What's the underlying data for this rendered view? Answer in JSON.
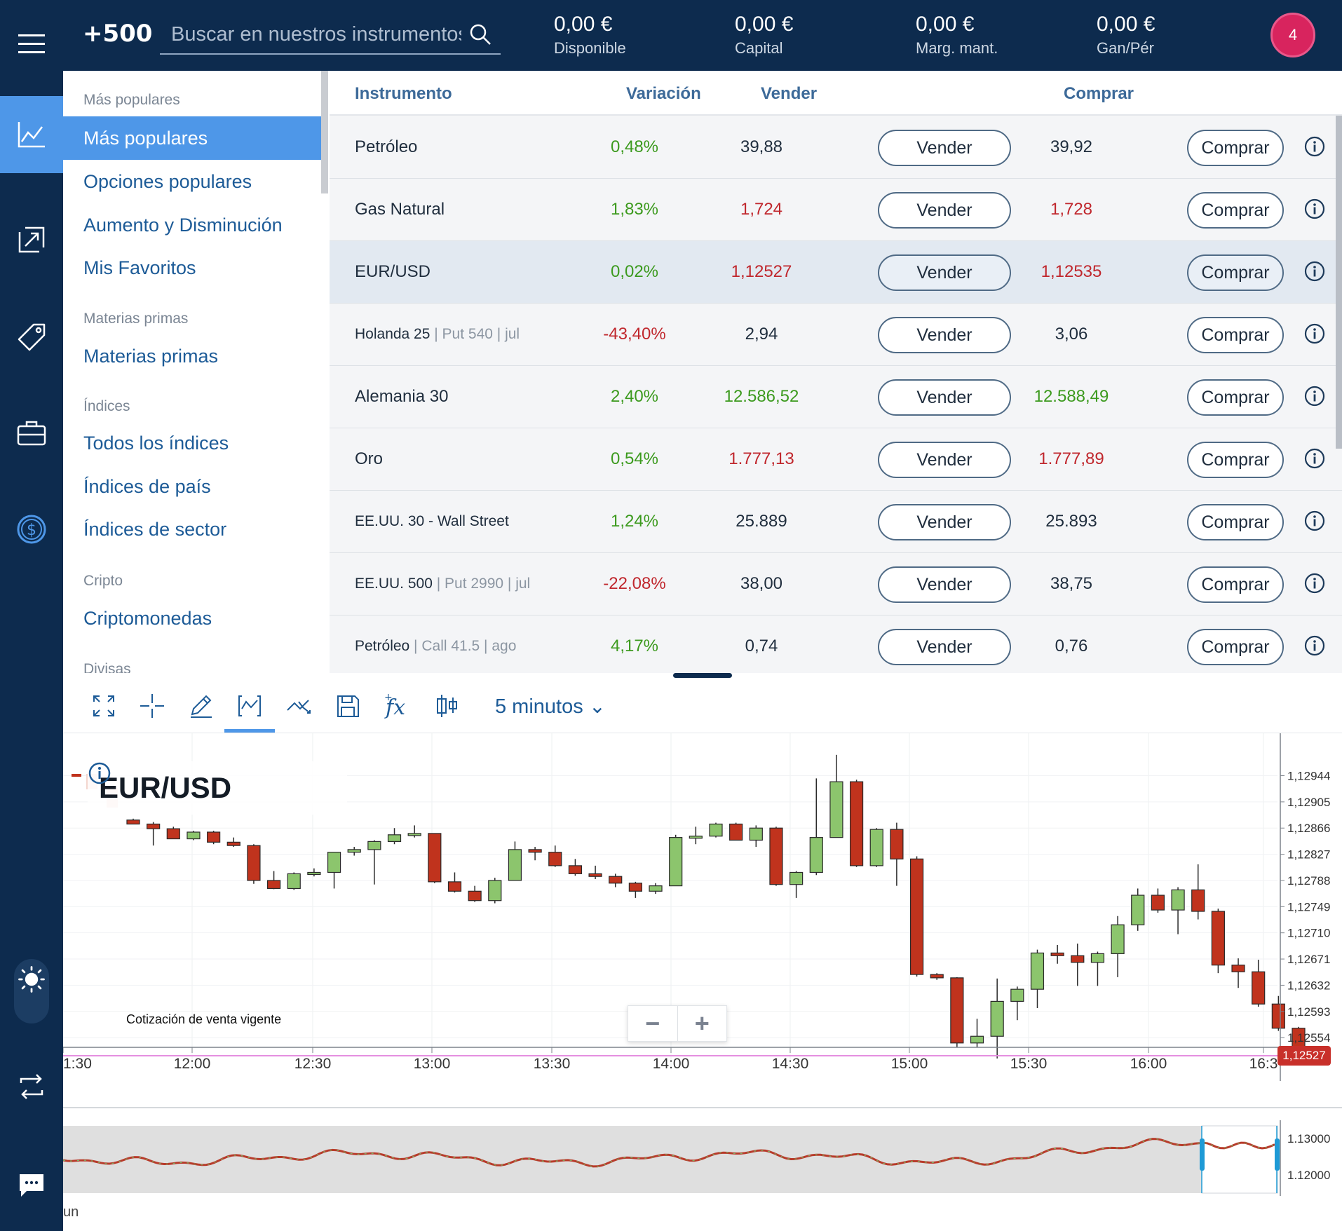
{
  "header": {
    "logo": "+500",
    "search_placeholder": "Buscar en nuestros instrumentos",
    "stats": [
      {
        "value": "0,00 €",
        "label": "Disponible"
      },
      {
        "value": "0,00 €",
        "label": "Capital"
      },
      {
        "value": "0,00 €",
        "label": "Marg. mant."
      },
      {
        "value": "0,00 €",
        "label": "Gan/Pér"
      }
    ],
    "notifications": "4"
  },
  "rail": [
    "menu-icon",
    "chart-icon",
    "trade-icon",
    "tag-icon",
    "briefcase-icon",
    "dollar-icon",
    "sun-icon",
    "swap-icon",
    "chat-icon"
  ],
  "categories": {
    "groups": [
      {
        "heading": "Más populares",
        "items": [
          "Más populares",
          "Opciones populares",
          "Aumento y Disminución",
          "Mis Favoritos"
        ]
      },
      {
        "heading": "Materias primas",
        "items": [
          "Materias primas"
        ]
      },
      {
        "heading": "Índices",
        "items": [
          "Todos los índices",
          "Índices de país",
          "Índices de sector"
        ]
      },
      {
        "heading": "Cripto",
        "items": [
          "Criptomonedas"
        ]
      },
      {
        "heading": "Divisas",
        "items": []
      }
    ],
    "active": "Más populares"
  },
  "table": {
    "headers": {
      "instrument": "Instrumento",
      "change": "Variación",
      "sell": "Vender",
      "buy": "Comprar"
    },
    "sell_label": "Vender",
    "buy_label": "Comprar",
    "rows": [
      {
        "name": "Petróleo",
        "sub": "",
        "change": "0,48%",
        "sell": "39,88",
        "buy": "39,92",
        "change_dir": "pos",
        "price_dir": "neu"
      },
      {
        "name": "Gas Natural",
        "sub": "",
        "change": "1,83%",
        "sell": "1,724",
        "buy": "1,728",
        "change_dir": "pos",
        "price_dir": "neg"
      },
      {
        "name": "EUR/USD",
        "sub": "",
        "change": "0,02%",
        "sell": "1,12527",
        "buy": "1,12535",
        "change_dir": "pos",
        "price_dir": "neg",
        "highlight": true
      },
      {
        "name": "Holanda 25",
        "sub": " | Put 540 | jul",
        "change": "-43,40%",
        "sell": "2,94",
        "buy": "3,06",
        "change_dir": "neg",
        "price_dir": "neu"
      },
      {
        "name": "Alemania 30",
        "sub": "",
        "change": "2,40%",
        "sell": "12.586,52",
        "buy": "12.588,49",
        "change_dir": "pos",
        "price_dir": "pos"
      },
      {
        "name": "Oro",
        "sub": "",
        "change": "0,54%",
        "sell": "1.777,13",
        "buy": "1.777,89",
        "change_dir": "pos",
        "price_dir": "neg"
      },
      {
        "name": "EE.UU. 30 - Wall Street",
        "sub": "",
        "change": "1,24%",
        "sell": "25.889",
        "buy": "25.893",
        "change_dir": "pos",
        "price_dir": "neu",
        "small": true
      },
      {
        "name": "EE.UU. 500",
        "sub": " | Put 2990 | jul",
        "change": "-22,08%",
        "sell": "38,00",
        "buy": "38,75",
        "change_dir": "neg",
        "price_dir": "neu"
      },
      {
        "name": "Petróleo",
        "sub": " | Call 41.5 | ago",
        "change": "4,17%",
        "sell": "0,74",
        "buy": "0,76",
        "change_dir": "pos",
        "price_dir": "neu"
      }
    ]
  },
  "toolbar": {
    "tools": [
      "fullscreen-icon",
      "crosshair-icon",
      "pencil-icon",
      "chart-type-icon",
      "indicator-icon",
      "save-icon",
      "function-icon",
      "candle-settings-icon"
    ],
    "active_tool": "chart-type-icon",
    "timeframe": "5 minutos ⌄"
  },
  "chart_data": {
    "type": "candlestick",
    "title": "EUR/USD",
    "x_tick_labels": [
      "1:30",
      "12:00",
      "12:30",
      "13:00",
      "13:30",
      "14:00",
      "14:30",
      "15:00",
      "15:30",
      "16:00",
      "16:3"
    ],
    "y_tick_labels": [
      "1,12944",
      "1,12905",
      "1,12866",
      "1,12827",
      "1,12788",
      "1,12749",
      "1,12710",
      "1,12671",
      "1,12632",
      "1,12593",
      "1,12554"
    ],
    "ylim": [
      1.12527,
      1.12965
    ],
    "current_price": 1.12527,
    "current_price_label": "1,12527",
    "current_price_caption": "Cotización de venta vigente",
    "candles": [
      [
        1.12878,
        1.1288,
        1.12872,
        1.12872
      ],
      [
        1.12872,
        1.12875,
        1.1284,
        1.12865
      ],
      [
        1.12865,
        1.12868,
        1.1285,
        1.1285
      ],
      [
        1.1285,
        1.12862,
        1.12848,
        1.1286
      ],
      [
        1.1286,
        1.12862,
        1.12842,
        1.12845
      ],
      [
        1.12845,
        1.12852,
        1.12838,
        1.1284
      ],
      [
        1.1284,
        1.12842,
        1.12783,
        1.12788
      ],
      [
        1.12788,
        1.12802,
        1.12775,
        1.12776
      ],
      [
        1.12776,
        1.128,
        1.12774,
        1.12798
      ],
      [
        1.12798,
        1.12806,
        1.12794,
        1.128
      ],
      [
        1.128,
        1.1283,
        1.12776,
        1.1283
      ],
      [
        1.1283,
        1.12838,
        1.12825,
        1.12834
      ],
      [
        1.12834,
        1.12848,
        1.12782,
        1.12846
      ],
      [
        1.12846,
        1.12866,
        1.12842,
        1.12856
      ],
      [
        1.12856,
        1.1287,
        1.12852,
        1.12858
      ],
      [
        1.12858,
        1.12858,
        1.12784,
        1.12786
      ],
      [
        1.12786,
        1.128,
        1.1277,
        1.12772
      ],
      [
        1.12772,
        1.1278,
        1.12756,
        1.12758
      ],
      [
        1.12758,
        1.12792,
        1.12754,
        1.12788
      ],
      [
        1.12788,
        1.12846,
        1.12788,
        1.12834
      ],
      [
        1.12834,
        1.12838,
        1.12818,
        1.1283
      ],
      [
        1.1283,
        1.1284,
        1.12808,
        1.1281
      ],
      [
        1.1281,
        1.1282,
        1.12795,
        1.12798
      ],
      [
        1.12798,
        1.1281,
        1.1279,
        1.12794
      ],
      [
        1.12794,
        1.12798,
        1.12778,
        1.12784
      ],
      [
        1.12784,
        1.12786,
        1.12762,
        1.12772
      ],
      [
        1.12772,
        1.12784,
        1.12768,
        1.1278
      ],
      [
        1.1278,
        1.12856,
        1.1278,
        1.12852
      ],
      [
        1.12852,
        1.12868,
        1.12842,
        1.12854
      ],
      [
        1.12854,
        1.12874,
        1.12852,
        1.12872
      ],
      [
        1.12872,
        1.12874,
        1.12848,
        1.12848
      ],
      [
        1.12848,
        1.1287,
        1.12838,
        1.12866
      ],
      [
        1.12866,
        1.12868,
        1.1278,
        1.12782
      ],
      [
        1.12782,
        1.12802,
        1.12762,
        1.128
      ],
      [
        1.128,
        1.1294,
        1.12796,
        1.12852
      ],
      [
        1.12852,
        1.12975,
        1.12852,
        1.12935
      ],
      [
        1.12935,
        1.12938,
        1.12808,
        1.1281
      ],
      [
        1.1281,
        1.12866,
        1.12808,
        1.12864
      ],
      [
        1.12864,
        1.12874,
        1.1278,
        1.1282
      ],
      [
        1.1282,
        1.12824,
        1.12645,
        1.12648
      ],
      [
        1.12648,
        1.1265,
        1.1264,
        1.12643
      ],
      [
        1.12643,
        1.12644,
        1.1254,
        1.12546
      ],
      [
        1.12546,
        1.12582,
        1.1254,
        1.12556
      ],
      [
        1.12556,
        1.12642,
        1.12523,
        1.12608
      ],
      [
        1.12608,
        1.1263,
        1.1258,
        1.12626
      ],
      [
        1.12626,
        1.12685,
        1.12598,
        1.1268
      ],
      [
        1.1268,
        1.12692,
        1.12664,
        1.12676
      ],
      [
        1.12676,
        1.12694,
        1.12631,
        1.12666
      ],
      [
        1.12666,
        1.12682,
        1.12631,
        1.12679
      ],
      [
        1.12679,
        1.12735,
        1.12644,
        1.12722
      ],
      [
        1.12722,
        1.12776,
        1.12713,
        1.12766
      ],
      [
        1.12766,
        1.12776,
        1.1274,
        1.12744
      ],
      [
        1.12744,
        1.12778,
        1.12708,
        1.12774
      ],
      [
        1.12774,
        1.12812,
        1.1273,
        1.12742
      ],
      [
        1.12742,
        1.12746,
        1.1265,
        1.12662
      ],
      [
        1.12662,
        1.12672,
        1.12628,
        1.12652
      ],
      [
        1.12652,
        1.1267,
        1.126,
        1.12604
      ],
      [
        1.12604,
        1.12616,
        1.12564,
        1.12568
      ],
      [
        1.12568,
        1.1257,
        1.12527,
        1.1253
      ]
    ],
    "navigator": {
      "y_tick_labels": [
        "1.13000",
        "1.12000"
      ],
      "x_tick_label": "un"
    }
  }
}
